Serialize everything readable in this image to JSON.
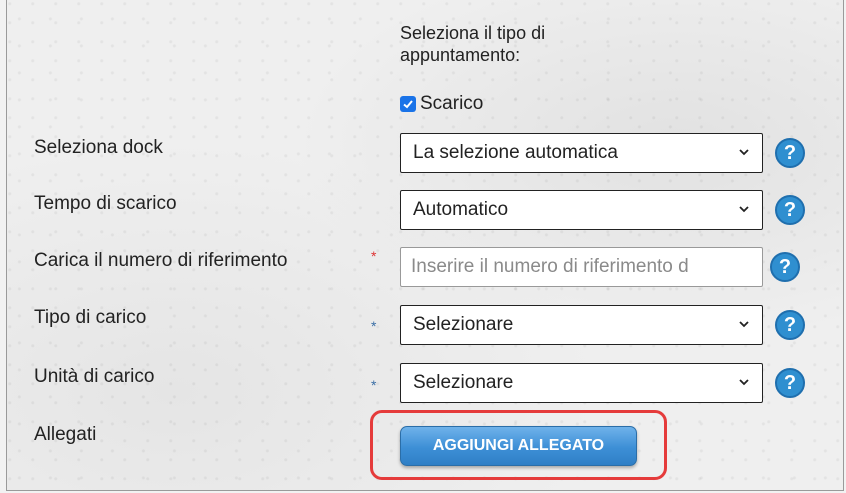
{
  "appointment": {
    "heading": "Seleziona il tipo di appuntamento:",
    "heading_line1": "Seleziona il tipo di",
    "heading_line2": "appuntamento:",
    "checkbox_label": "Scarico",
    "checkbox_checked": true
  },
  "fields": {
    "dock": {
      "label": "Seleziona dock",
      "value": "La selezione automatica"
    },
    "time": {
      "label": "Tempo di scarico",
      "value": "Automatico"
    },
    "reference": {
      "label": "Carica il numero di riferimento",
      "required_marker": "*",
      "placeholder": "Inserire il numero di riferimento d"
    },
    "load_type": {
      "label": "Tipo di carico",
      "required_marker": "*",
      "value": "Selezionare"
    },
    "load_unit": {
      "label": "Unità di carico",
      "required_marker": "*",
      "value": "Selezionare"
    },
    "attachments": {
      "label": "Allegati",
      "button_label": "AGGIUNGI ALLEGATO"
    }
  },
  "help_icon_text": "?",
  "colors": {
    "accent": "#2f8fd0",
    "checkbox": "#1a73e8",
    "highlight": "#e53b3b",
    "required_red": "#dd3333",
    "required_blue": "#3a6ea5"
  }
}
